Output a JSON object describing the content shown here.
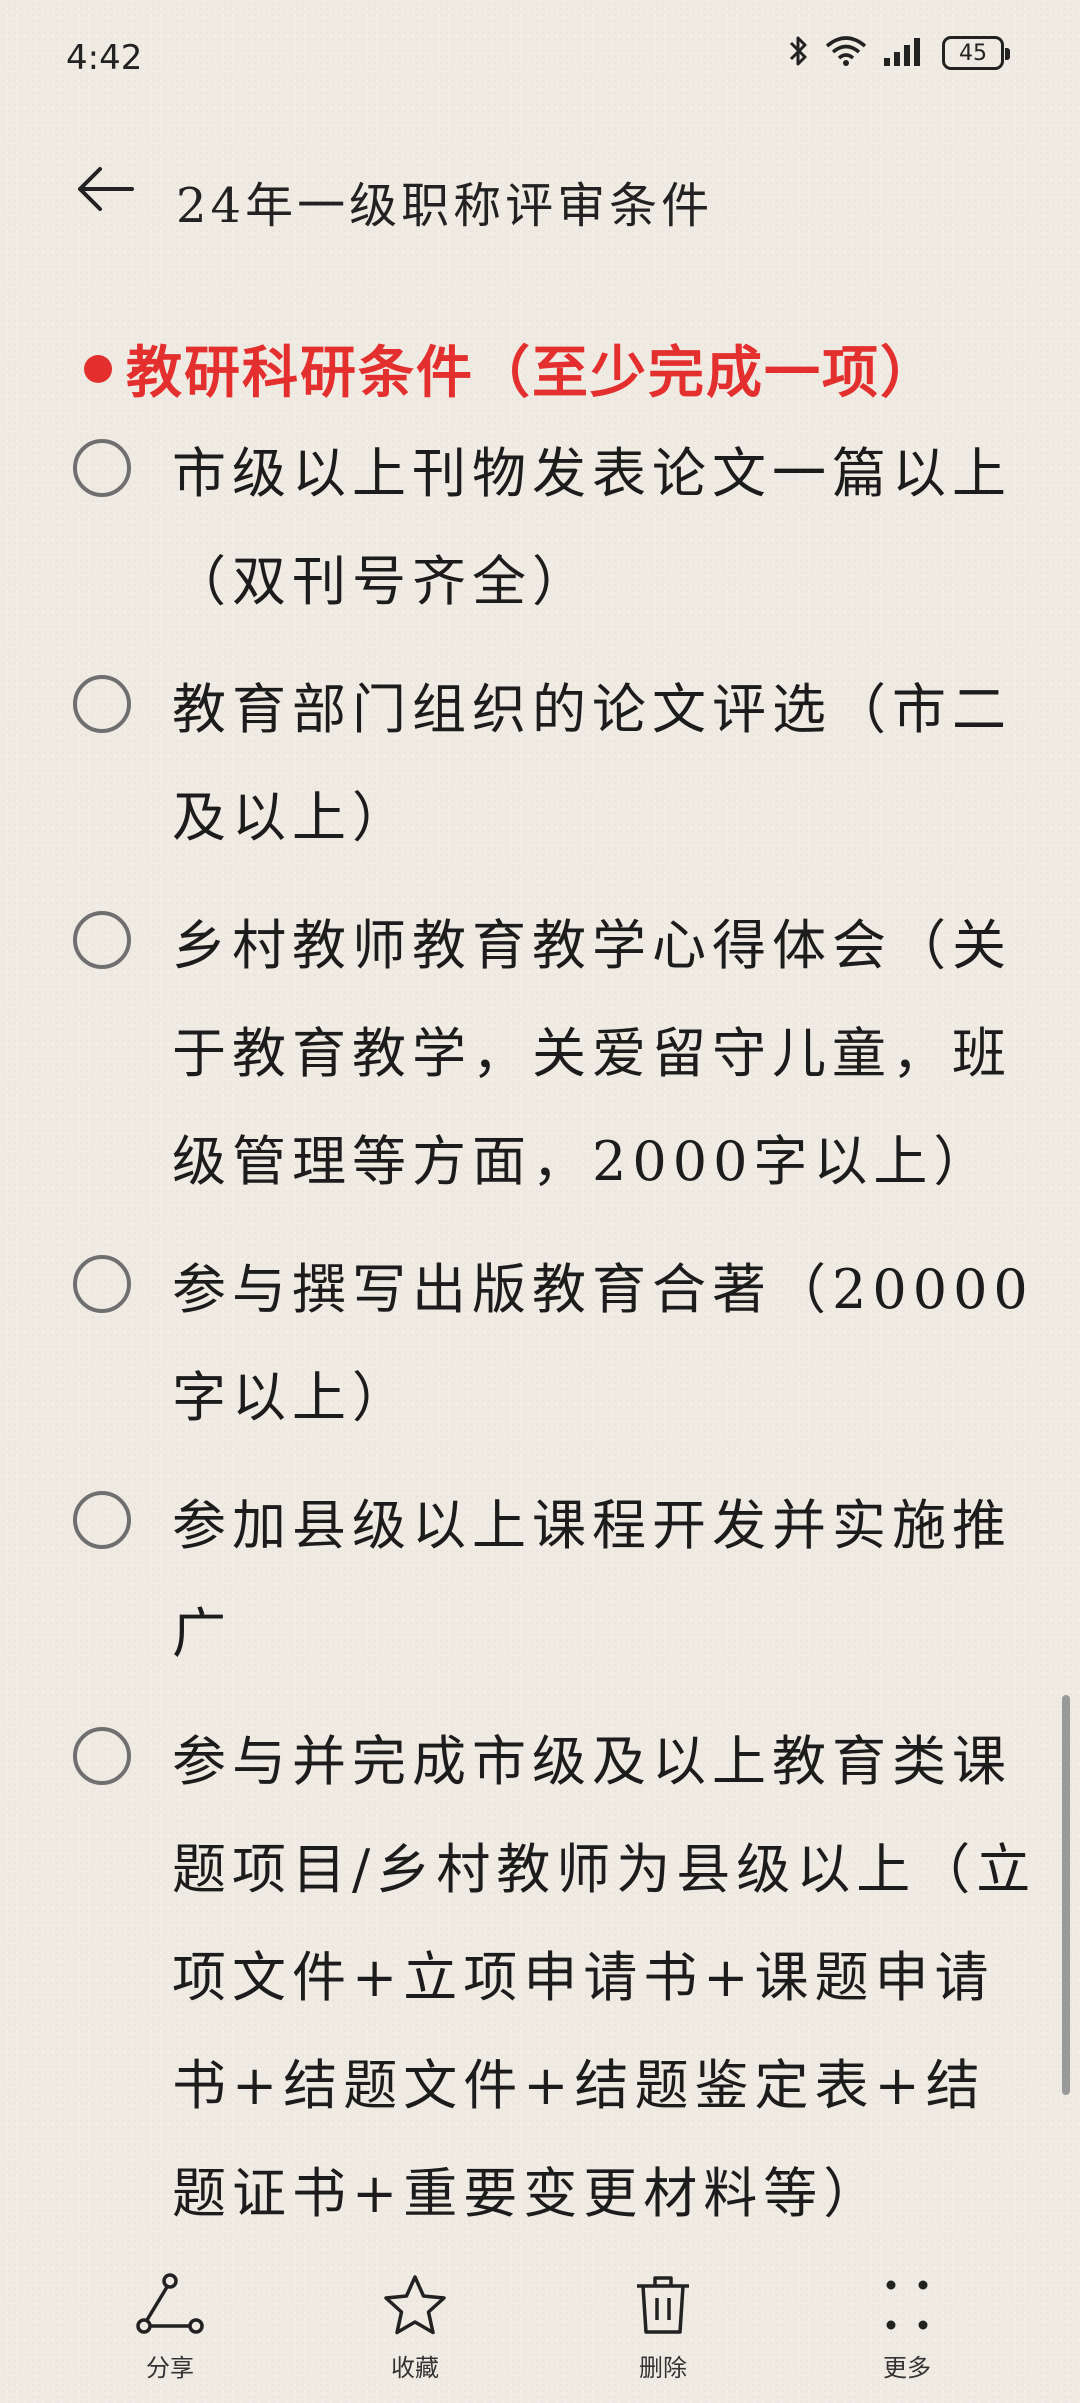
{
  "status_bar": {
    "time": "4:42",
    "battery": "45"
  },
  "header": {
    "title": "24年一级职称评审条件"
  },
  "section": {
    "title": "教研科研条件（至少完成一项）"
  },
  "todo_items": [
    {
      "text": "市级以上刊物发表论文一篇以上（双刊号齐全）"
    },
    {
      "text": "教育部门组织的论文评选（市二及以上）"
    },
    {
      "text": "乡村教师教育教学心得体会（关于教育教学，关爱留守儿童，班级管理等方面，2000字以上）"
    },
    {
      "text": "参与撰写出版教育合著（20000字以上）"
    },
    {
      "text": "参加县级以上课程开发并实施推广"
    },
    {
      "text": "参与并完成市级及以上教育类课题项目/乡村教师为县级以上（立项文件+立项申请书+课题申请书+结题文件+结题鉴定表+结题证书+重要变更材料等）"
    }
  ],
  "toolbar": {
    "share": "分享",
    "favorite": "收藏",
    "delete": "删除",
    "more": "更多"
  },
  "colors": {
    "accent": "#e3302f",
    "background": "#efebe3",
    "text": "#1c1c1c"
  },
  "icons": [
    "back-arrow-icon",
    "bluetooth-icon",
    "wifi-icon",
    "signal-icon",
    "battery-icon",
    "share-icon",
    "star-icon",
    "trash-icon",
    "more-icon"
  ]
}
